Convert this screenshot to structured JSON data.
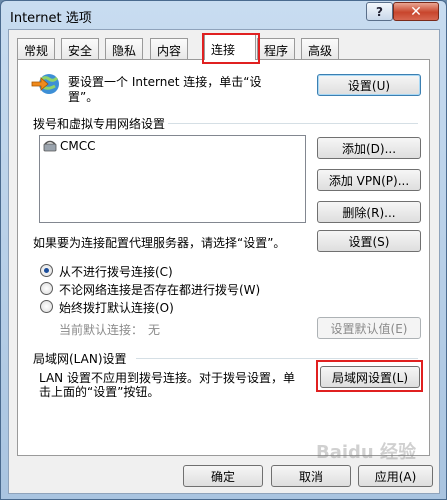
{
  "window": {
    "title": "Internet 选项",
    "help_label": "?",
    "close_label": "✕"
  },
  "tabs": [
    "常规",
    "安全",
    "隐私",
    "内容",
    "连接",
    "程序",
    "高级"
  ],
  "active_tab": "连接",
  "setup": {
    "text_line1": "要设置一个 Internet 连接，单击“设",
    "text_line2": "置”。",
    "button": "设置(U)",
    "icon": "globe-arrow-icon"
  },
  "dialup": {
    "section_label": "拨号和虚拟专用网络设置",
    "connections": [
      {
        "name": "CMCC",
        "icon": "phone-icon"
      }
    ],
    "add_button": "添加(D)...",
    "add_vpn_button": "添加 VPN(P)...",
    "remove_button": "删除(R)...",
    "proxy_hint": "如果要为连接配置代理服务器，请选择“设置”。",
    "settings_button": "设置(S)"
  },
  "dial_options": [
    {
      "label": "从不进行拨号连接(C)",
      "selected": true
    },
    {
      "label": "不论网络连接是否存在都进行拨号(W)",
      "selected": false
    },
    {
      "label": "始终拨打默认连接(O)",
      "selected": false
    }
  ],
  "default_connection": {
    "label": "当前默认连接：",
    "value": "无",
    "button": "设置默认值(E)"
  },
  "lan": {
    "section_label": "局域网(LAN)设置",
    "text_line1": "LAN 设置不应用到拨号连接。对于拨号设置，单",
    "text_line2": "击上面的“设置”按钮。",
    "button": "局域网设置(L)"
  },
  "footer": {
    "ok": "确定",
    "cancel": "取消",
    "apply": "应用(A)"
  },
  "watermark": "Baidu 经验",
  "colors": {
    "highlight": "#e02020",
    "radio_dot": "#1b4d9b"
  }
}
